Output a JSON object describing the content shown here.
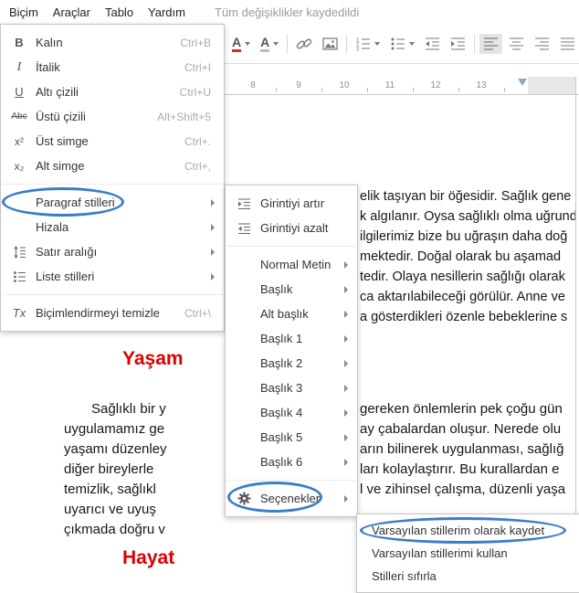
{
  "menubar": {
    "items": [
      {
        "label": "Biçim"
      },
      {
        "label": "Araçlar"
      },
      {
        "label": "Tablo"
      },
      {
        "label": "Yardım"
      }
    ],
    "status": "Tüm değişiklikler kaydedildi"
  },
  "ruler": {
    "numbers": [
      "8",
      "9",
      "10",
      "11",
      "12",
      "13"
    ]
  },
  "icons": {
    "bold": "B",
    "italic": "I",
    "underline": "U",
    "strikethrough": "Abc",
    "superscript": "x²",
    "subscript": "x₂",
    "clear_format": "Tx",
    "text_color": "A",
    "highlight_color": "A"
  },
  "format_menu": {
    "items": [
      {
        "label": "Kalın",
        "shortcut": "Ctrl+B"
      },
      {
        "label": "İtalik",
        "shortcut": "Ctrl+I"
      },
      {
        "label": "Altı çizili",
        "shortcut": "Ctrl+U"
      },
      {
        "label": "Üstü çizili",
        "shortcut": "Alt+Shift+5"
      },
      {
        "label": "Üst simge",
        "shortcut": "Ctrl+."
      },
      {
        "label": "Alt simge",
        "shortcut": "Ctrl+,"
      },
      {
        "label": "Paragraf stilleri"
      },
      {
        "label": "Hizala"
      },
      {
        "label": "Satır aralığı"
      },
      {
        "label": "Liste stilleri"
      },
      {
        "label": "Biçimlendirmeyi temizle",
        "shortcut": "Ctrl+\\"
      }
    ]
  },
  "styles_menu": {
    "items": [
      {
        "label": "Girintiyi artır"
      },
      {
        "label": "Girintiyi azalt"
      },
      {
        "label": "Normal Metin"
      },
      {
        "label": "Başlık"
      },
      {
        "label": "Alt başlık"
      },
      {
        "label": "Başlık 1"
      },
      {
        "label": "Başlık 2"
      },
      {
        "label": "Başlık 3"
      },
      {
        "label": "Başlık 4"
      },
      {
        "label": "Başlık 5"
      },
      {
        "label": "Başlık 6"
      },
      {
        "label": "Seçenekler"
      }
    ]
  },
  "options_menu": {
    "items": [
      {
        "label": "Varsayılan stillerim olarak kaydet"
      },
      {
        "label": "Varsayılan stillerimi kullan"
      },
      {
        "label": "Stilleri sıfırla"
      }
    ]
  },
  "document": {
    "heading1": "Yaşam",
    "heading2": "Hayat",
    "top_lines": [
      "elik taşıyan bir öğesidir. Sağlık gene",
      "k algılanır. Oysa sağlıklı olma uğrund",
      "ilgilerimiz bize bu uğraşın daha doğ",
      "mektedir. Doğal olarak bu aşamad",
      "tedir. Olaya nesillerin sağlığı olarak",
      "ca aktarılabileceği görülür. Anne ve",
      "a gösterdikleri özenle bebeklerine s"
    ],
    "left_lines": [
      "Sağlıklı bir y",
      "uygulamamız ge",
      "yaşamı düzenley",
      "diğer bireylerle",
      "temizlik, sağlıkl",
      "uyarıcı ve uyuş",
      "çıkmada doğru v"
    ],
    "right_lines": [
      "gereken önlemlerin pek çoğu gün",
      "ay çabalardan oluşur. Nerede olu",
      "arın bilinerek uygulanması, sağlığ",
      "ları kolaylaştırır. Bu kurallardan e",
      "l ve zihinsel çalışma, düzenli yaşa"
    ]
  },
  "colors": {
    "heading_red": "#dd0000",
    "annotation_blue": "#3b7dc8",
    "text_color_bar": "#dd2c1c"
  }
}
